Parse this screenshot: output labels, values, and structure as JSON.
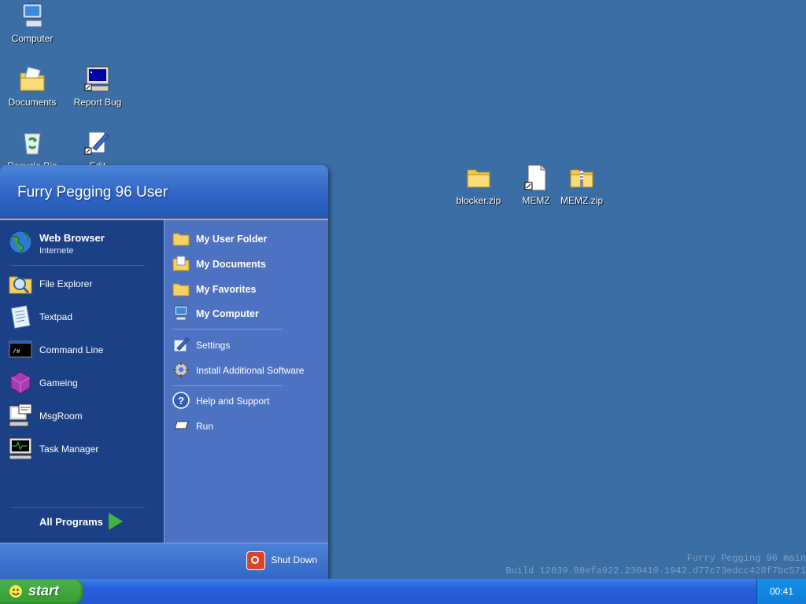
{
  "desktop": {
    "icons": [
      {
        "label": "Computer"
      },
      {
        "label": "Documents"
      },
      {
        "label": "Report Bug"
      },
      {
        "label": "Recycle Bin"
      },
      {
        "label": "Edit"
      },
      {
        "label": "blocker.zip"
      },
      {
        "label": "MEMZ"
      },
      {
        "label": "MEMZ.zip"
      }
    ]
  },
  "watermark": {
    "line1": "Furry Pegging 96 main",
    "line2": "Build 12839.88efa922.230410-1942.d77c73edcc428f7bc571"
  },
  "start_menu": {
    "user_name": "Furry Pegging 96 User",
    "left_items": [
      {
        "label": "Web Browser",
        "sub": "Internete",
        "icon": "globe-icon"
      },
      {
        "label": "File Explorer",
        "icon": "magnifier-folder-icon"
      },
      {
        "label": "Textpad",
        "icon": "notepad-icon"
      },
      {
        "label": "Command Line",
        "icon": "terminal-icon"
      },
      {
        "label": "Gameing",
        "icon": "cube-icon"
      },
      {
        "label": "MsgRoom",
        "icon": "chat-computer-icon"
      },
      {
        "label": "Task Manager",
        "icon": "monitor-pulse-icon"
      }
    ],
    "all_programs": "All Programs",
    "right_items": [
      {
        "label": "My User Folder",
        "icon": "folder-icon"
      },
      {
        "label": "My Documents",
        "icon": "documents-icon"
      },
      {
        "label": "My Favorites",
        "icon": "folder-icon"
      },
      {
        "label": "My Computer",
        "icon": "computer-icon"
      },
      {
        "label": "Settings",
        "icon": "settings-icon"
      },
      {
        "label": "Install Additional Software",
        "icon": "install-icon"
      },
      {
        "label": "Help and Support",
        "icon": "help-icon"
      },
      {
        "label": "Run",
        "icon": "run-icon"
      }
    ],
    "shutdown": "Shut Down"
  },
  "taskbar": {
    "start_label": "start",
    "clock": "00:41"
  },
  "colors": {
    "desktop": "#3a6ea5",
    "taskbar": "#245edc",
    "start_button": "#339c30",
    "menu_left": "#1c4086",
    "menu_right": "#4e72c2"
  }
}
